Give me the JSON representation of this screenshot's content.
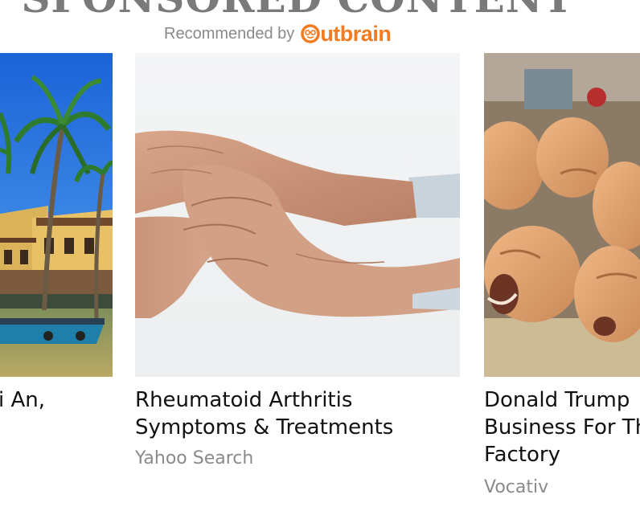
{
  "widget": {
    "heading": "SPONSORED CONTENT",
    "recommended_label": "Recommended by",
    "brand_name": "utbrain",
    "brand_color": "#f47b20"
  },
  "cards": [
    {
      "title_lines": [
        "i An,"
      ],
      "image": "beach-palm-town-photo"
    },
    {
      "title_lines": [
        "Rheumatoid Arthritis",
        "Symptoms & Treatments"
      ],
      "source": "Yahoo Search",
      "image": "holding-hands-photo"
    },
    {
      "title_lines": [
        "Donald Trump",
        "Business For Th",
        "Factory"
      ],
      "source": "Vocativ",
      "image": "trump-masks-photo"
    }
  ]
}
